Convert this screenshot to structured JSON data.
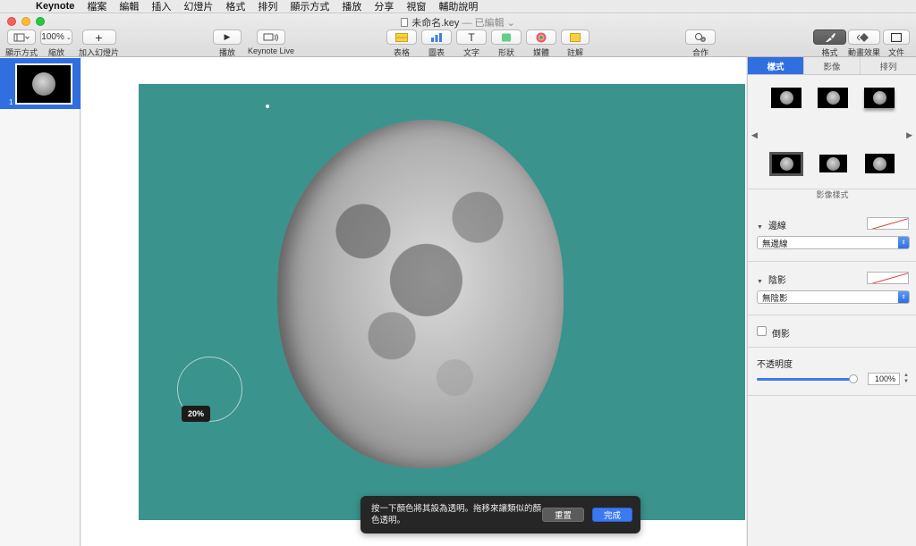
{
  "menubar": {
    "apple": "",
    "items": [
      "Keynote",
      "檔案",
      "編輯",
      "插入",
      "幻燈片",
      "格式",
      "排列",
      "顯示方式",
      "播放",
      "分享",
      "視窗",
      "輔助說明"
    ]
  },
  "window": {
    "title": "未命名.key",
    "status": "— 已編輯 ⌄"
  },
  "toolbar": {
    "view_label": "顯示方式",
    "zoom_value": "100%",
    "zoom_label": "縮放",
    "add_slide_label": "加入幻燈片",
    "play_label": "播放",
    "keynote_live_label": "Keynote Live",
    "table_label": "表格",
    "chart_label": "圖表",
    "text_label": "文字",
    "shape_label": "形狀",
    "media_label": "媒體",
    "comment_label": "註解",
    "collaborate_label": "合作",
    "format_label": "格式",
    "animate_label": "動畫效果",
    "document_label": "文件"
  },
  "navigator": {
    "slide_number": "1"
  },
  "canvas": {
    "slide_background": "#3a938d",
    "magnifier_percent": "20%"
  },
  "hud": {
    "message": "按一下顏色將其設為透明。拖移來讓類似的顏色透明。",
    "reset_label": "重置",
    "done_label": "完成"
  },
  "inspector": {
    "tabs": [
      "樣式",
      "影像",
      "排列"
    ],
    "active_tab": 0,
    "image_styles_label": "影像樣式",
    "border": {
      "label": "邊線",
      "value": "無邊線"
    },
    "shadow": {
      "label": "陰影",
      "value": "無陰影"
    },
    "reflection_label": "倒影",
    "opacity": {
      "label": "不透明度",
      "value": "100%",
      "fraction": 1.0
    }
  },
  "colors": {
    "accent": "#2f6fe0",
    "slide_teal": "#3a938d",
    "hud_bg": "#262626"
  }
}
